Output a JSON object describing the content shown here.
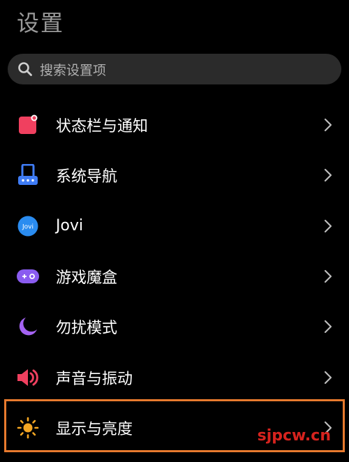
{
  "header": {
    "title": "设置"
  },
  "search": {
    "placeholder": "搜索设置项",
    "icon": "search-icon"
  },
  "settings_items": [
    {
      "label": "状态栏与通知",
      "icon": "status-bar-notification-icon",
      "color": "#f0405f"
    },
    {
      "label": "系统导航",
      "icon": "system-navigation-icon",
      "color": "#3f7cf5"
    },
    {
      "label": "Jovi",
      "icon": "jovi-icon",
      "color": "#2a8cf0"
    },
    {
      "label": "游戏魔盒",
      "icon": "game-box-icon",
      "color": "#8a5cf0"
    },
    {
      "label": "勿扰模式",
      "icon": "do-not-disturb-moon-icon",
      "color": "#a463f2"
    },
    {
      "label": "声音与振动",
      "icon": "sound-vibration-icon",
      "color": "#f0405f"
    },
    {
      "label": "显示与亮度",
      "icon": "display-brightness-sun-icon",
      "color": "#f5a623"
    }
  ],
  "watermark": "sjpcw.cn",
  "colors": {
    "background": "#000000",
    "highlight_border": "#e87a2e",
    "watermark": "#d6231e"
  }
}
